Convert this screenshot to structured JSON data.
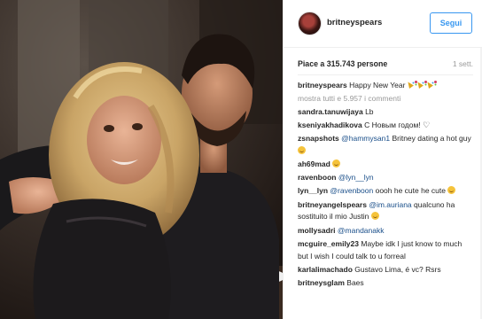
{
  "post": {
    "username": "britneyspears",
    "follow_label": "Segui",
    "likes": "Piace a 315.743 persone",
    "time": "1 sett.",
    "load_more": "mostra tutti e 5.957 i commenti"
  },
  "comments": [
    {
      "user": "britneyspears",
      "text": "Happy New Year",
      "emoji": "party-popper-x3"
    },
    {
      "user": "sandra.tanuwijaya",
      "text": "Lb"
    },
    {
      "user": "kseniyakhadikova",
      "text": "С Новым годом!",
      "emoji": "heart-outline"
    },
    {
      "user": "zsnapshots",
      "mention": "@hammysan1",
      "text": "Britney dating a hot guy",
      "emoji": "smirk"
    },
    {
      "user": "ah69mad",
      "text": "",
      "emoji": "grinning-sweat"
    },
    {
      "user": "ravenboon",
      "mention": "@lyn__lyn",
      "text": ""
    },
    {
      "user": "lyn__lyn",
      "mention": "@ravenboon",
      "text": "oooh he cute he cute",
      "emoji": "smiling-blush"
    },
    {
      "user": "britneyangelspears",
      "mention": "@im.auriana",
      "text": "qualcuno ha sostituito il mio Justin",
      "emoji": "crying"
    },
    {
      "user": "mollysadri",
      "mention": "@mandanakk",
      "text": ""
    },
    {
      "user": "mcguire_emily23",
      "text": "Maybe idk I just know to much but I wish I could talk to u forreal"
    },
    {
      "user": "karlalimachado",
      "text": "Gustavo Lima, é vc? Rsrs"
    },
    {
      "user": "britneysglam",
      "text": "Baes"
    }
  ],
  "icons": {
    "avatar": "profile-avatar",
    "photo": "post-photo"
  },
  "colors": {
    "accent": "#3897f0",
    "mention": "#1a4f8a",
    "muted": "#999999"
  }
}
